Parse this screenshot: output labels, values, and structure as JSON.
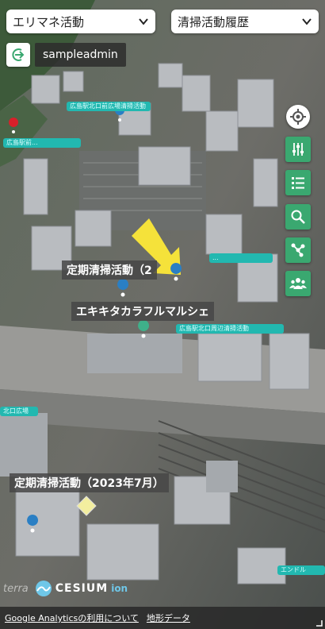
{
  "dropdowns": {
    "left": {
      "value": "エリマネ活動"
    },
    "right": {
      "value": "清掃活動履歴"
    }
  },
  "user": {
    "name": "sampleadmin"
  },
  "map_labels": {
    "label1": "定期清掃活動（2",
    "label2": "エキキタカラフルマルシェ",
    "label3": "定期清掃活動（2023年7月）"
  },
  "teal_tags": {
    "t1": "広島駅北口前広場清掃活動",
    "t2": "広島駅前...",
    "t3": "...",
    "t4": "広島駅北口周辺清掃活動",
    "t5": "北口広場",
    "t6": "エンドル"
  },
  "logos": {
    "terra": "terra",
    "cesium": "CESIUM",
    "ion": "ion"
  },
  "credits": {
    "analytics": "Google Analyticsの利用について",
    "terrain": "地形データ"
  },
  "colors": {
    "tool_green": "#3aa870",
    "tag_teal": "#22b8b0",
    "arrow_yellow": "#f5e23a",
    "pin_blue": "#2a7fc4",
    "pin_red": "#d9202a"
  }
}
